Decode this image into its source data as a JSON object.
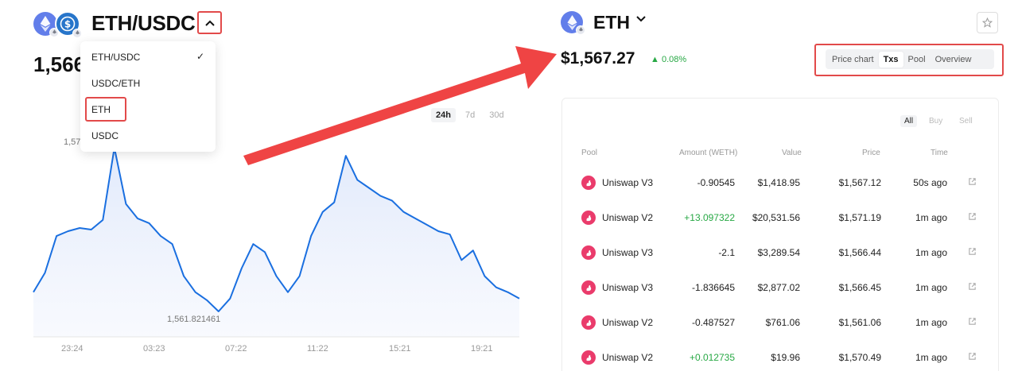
{
  "left": {
    "pair_title": "ETH/USDC",
    "price_partial": "1,566",
    "dropdown": {
      "items": [
        "ETH/USDC",
        "USDC/ETH",
        "ETH",
        "USDC"
      ],
      "selected_check": "✓"
    },
    "range_tabs": [
      "24h",
      "7d",
      "30d"
    ],
    "chart": {
      "high_label": "1,57",
      "low_label": "1,561.821461",
      "x_ticks": [
        "23:24",
        "03:23",
        "07:22",
        "11:22",
        "15:21",
        "19:21"
      ]
    }
  },
  "chart_data": {
    "type": "area",
    "x": [
      "23:24",
      "03:23",
      "07:22",
      "11:22",
      "15:21",
      "19:21"
    ],
    "ylabel": "",
    "min_label": "1,561.821461",
    "series": [
      {
        "values": [
          1563.0,
          1564.2,
          1566.5,
          1566.8,
          1567.0,
          1566.9,
          1567.5,
          1572.0,
          1568.5,
          1567.6,
          1567.3,
          1566.5,
          1566.0,
          1564.0,
          1563.0,
          1562.5,
          1561.8,
          1562.6,
          1564.5,
          1566.0,
          1565.5,
          1564.0,
          1563.0,
          1564.0,
          1566.5,
          1568.0,
          1568.6,
          1571.5,
          1570.0,
          1569.5,
          1569.0,
          1568.7,
          1568.0,
          1567.6,
          1567.2,
          1566.8,
          1566.6,
          1565.0,
          1565.6,
          1564.0,
          1563.3,
          1563.0,
          1562.6
        ]
      }
    ]
  },
  "right": {
    "token_name": "ETH",
    "price": "$1,567.27",
    "price_change": "0.08%",
    "tabs": [
      "Price chart",
      "Txs",
      "Pool",
      "Overview"
    ],
    "active_tab": "Txs",
    "filters": [
      "All",
      "Buy",
      "Sell"
    ],
    "columns": [
      "Pool",
      "Amount (WETH)",
      "Value",
      "Price",
      "Time"
    ],
    "rows": [
      {
        "pool": "Uniswap V3",
        "amount": "-0.90545",
        "value": "$1,418.95",
        "price": "$1,567.12",
        "time": "50s ago"
      },
      {
        "pool": "Uniswap V2",
        "amount": "+13.097322",
        "value": "$20,531.56",
        "price": "$1,571.19",
        "time": "1m ago"
      },
      {
        "pool": "Uniswap V3",
        "amount": "-2.1",
        "value": "$3,289.54",
        "price": "$1,566.44",
        "time": "1m ago"
      },
      {
        "pool": "Uniswap V3",
        "amount": "-1.836645",
        "value": "$2,877.02",
        "price": "$1,566.45",
        "time": "1m ago"
      },
      {
        "pool": "Uniswap V2",
        "amount": "-0.487527",
        "value": "$761.06",
        "price": "$1,561.06",
        "time": "1m ago"
      },
      {
        "pool": "Uniswap V2",
        "amount": "+0.012735",
        "value": "$19.96",
        "price": "$1,570.49",
        "time": "1m ago"
      }
    ]
  },
  "colors": {
    "accent_red": "#e24a4a",
    "line_blue": "#1a6fe0",
    "positive_green": "#27a844",
    "uniswap_pink": "#ea3b6b"
  }
}
